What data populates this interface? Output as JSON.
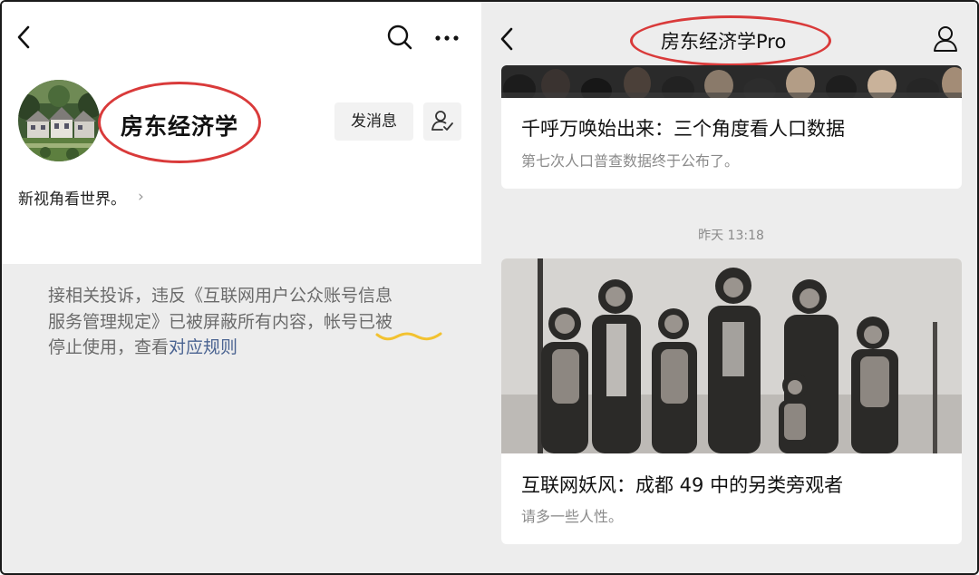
{
  "left_panel": {
    "account_name": "房东经济学",
    "send_message_label": "发消息",
    "description": "新视角看世界。",
    "description_chevron": "›",
    "notice": {
      "line1": "接相关投诉，违反《互联网用户公众账号信息",
      "line2": "服务管理规定》已被屏蔽所有内容，帐号已被",
      "line3_prefix": "停止使用，查看",
      "line3_link": "对应规则"
    }
  },
  "right_panel": {
    "title": "房东经济学Pro",
    "article1": {
      "title": "千呼万唤始出来：三个角度看人口数据",
      "subtitle": "第七次人口普查数据终于公布了。"
    },
    "timestamp": "昨天 13:18",
    "article2": {
      "title": "互联网妖风：成都 49 中的另类旁观者",
      "subtitle": "请多一些人性。"
    }
  },
  "icons": [
    "back-icon",
    "search-icon",
    "more-icon",
    "follow-icon",
    "user-icon",
    "chevron-right-icon"
  ],
  "colors": {
    "annotation_red": "#d93a3a",
    "annotation_yellow": "#f2c230",
    "link_blue": "#4a6391",
    "background_gray": "#ededed"
  }
}
